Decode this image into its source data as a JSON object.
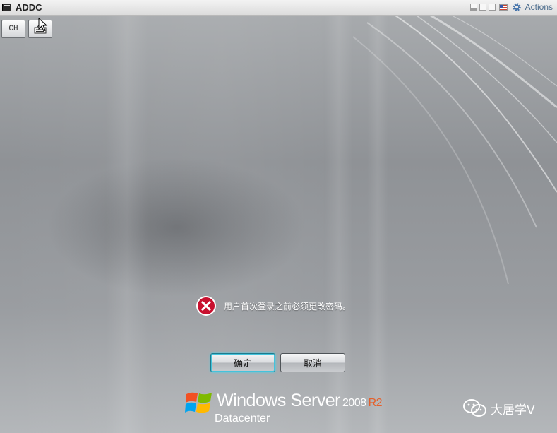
{
  "window": {
    "title": "ADDC",
    "actions_label": "Actions"
  },
  "toolbar": {
    "language_label": "CH"
  },
  "dialog": {
    "message": "用户首次登录之前必须更改密码。",
    "ok_label": "确定",
    "cancel_label": "取消"
  },
  "branding": {
    "product": "Windows Server",
    "version": "2008",
    "release": "R2",
    "edition": "Datacenter"
  },
  "watermark": {
    "text": "大居学V"
  },
  "colors": {
    "accent_focus": "#43c3dc",
    "error_red": "#c8102e",
    "r2_orange": "#e5602b"
  }
}
